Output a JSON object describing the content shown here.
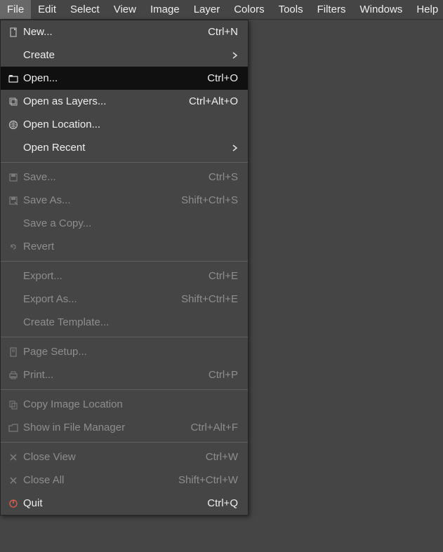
{
  "menubar": {
    "items": [
      {
        "label": "File"
      },
      {
        "label": "Edit"
      },
      {
        "label": "Select"
      },
      {
        "label": "View"
      },
      {
        "label": "Image"
      },
      {
        "label": "Layer"
      },
      {
        "label": "Colors"
      },
      {
        "label": "Tools"
      },
      {
        "label": "Filters"
      },
      {
        "label": "Windows"
      },
      {
        "label": "Help"
      }
    ],
    "activeIndex": 0
  },
  "fileMenu": {
    "items": [
      {
        "label": "New...",
        "shortcut": "Ctrl+N",
        "icon": "file-new-icon"
      },
      {
        "label": "Create",
        "submenu": true
      },
      {
        "label": "Open...",
        "shortcut": "Ctrl+O",
        "icon": "open-icon",
        "highlight": true
      },
      {
        "label": "Open as Layers...",
        "shortcut": "Ctrl+Alt+O",
        "icon": "layers-icon"
      },
      {
        "label": "Open Location...",
        "icon": "globe-icon"
      },
      {
        "label": "Open Recent",
        "submenu": true
      },
      {
        "separator": true
      },
      {
        "label": "Save...",
        "shortcut": "Ctrl+S",
        "icon": "save-icon",
        "disabled": true
      },
      {
        "label": "Save As...",
        "shortcut": "Shift+Ctrl+S",
        "icon": "save-as-icon",
        "disabled": true
      },
      {
        "label": "Save a Copy...",
        "disabled": true
      },
      {
        "label": "Revert",
        "icon": "revert-icon",
        "disabled": true
      },
      {
        "separator": true
      },
      {
        "label": "Export...",
        "shortcut": "Ctrl+E",
        "disabled": true
      },
      {
        "label": "Export As...",
        "shortcut": "Shift+Ctrl+E",
        "disabled": true
      },
      {
        "label": "Create Template...",
        "disabled": true
      },
      {
        "separator": true
      },
      {
        "label": "Page Setup...",
        "icon": "page-setup-icon",
        "disabled": true
      },
      {
        "label": "Print...",
        "shortcut": "Ctrl+P",
        "icon": "print-icon",
        "disabled": true
      },
      {
        "separator": true
      },
      {
        "label": "Copy Image Location",
        "icon": "copy-icon",
        "disabled": true
      },
      {
        "label": "Show in File Manager",
        "shortcut": "Ctrl+Alt+F",
        "icon": "folder-icon",
        "disabled": true
      },
      {
        "separator": true
      },
      {
        "label": "Close View",
        "shortcut": "Ctrl+W",
        "icon": "close-icon",
        "disabled": true
      },
      {
        "label": "Close All",
        "shortcut": "Shift+Ctrl+W",
        "icon": "close-icon",
        "disabled": true
      },
      {
        "label": "Quit",
        "shortcut": "Ctrl+Q",
        "icon": "quit-icon"
      }
    ]
  }
}
